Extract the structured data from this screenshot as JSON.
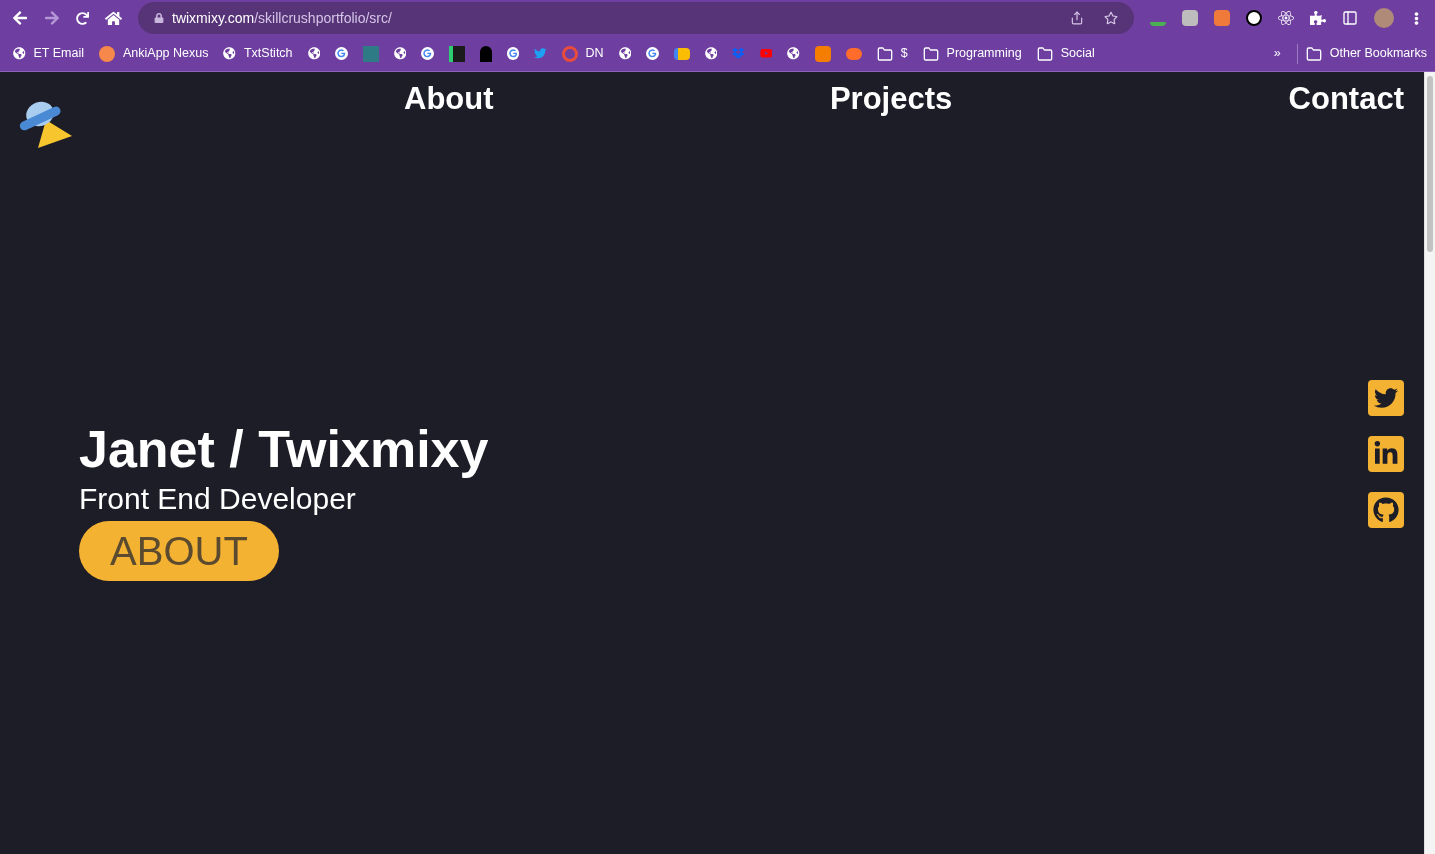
{
  "browser": {
    "url_host": "twixmixy.com",
    "url_path": "/skillcrushportfolio/src/"
  },
  "bookmarks": [
    {
      "kind": "site",
      "label": "ET Email"
    },
    {
      "kind": "site",
      "label": "AnkiApp Nexus"
    },
    {
      "kind": "site",
      "label": "TxtStitch"
    },
    {
      "kind": "site"
    },
    {
      "kind": "site"
    },
    {
      "kind": "site"
    },
    {
      "kind": "site"
    },
    {
      "kind": "site"
    },
    {
      "kind": "site"
    },
    {
      "kind": "site"
    },
    {
      "kind": "site"
    },
    {
      "kind": "site"
    },
    {
      "kind": "site",
      "label": "DN"
    },
    {
      "kind": "site"
    },
    {
      "kind": "site"
    },
    {
      "kind": "site"
    },
    {
      "kind": "site"
    },
    {
      "kind": "site"
    },
    {
      "kind": "site"
    },
    {
      "kind": "site"
    },
    {
      "kind": "site"
    },
    {
      "kind": "site"
    },
    {
      "kind": "folder",
      "label": "$"
    },
    {
      "kind": "folder",
      "label": "Programming"
    },
    {
      "kind": "folder",
      "label": "Social"
    }
  ],
  "bookmarks_overflow": "»",
  "other_bookmarks": "Other Bookmarks",
  "nav": [
    "About",
    "Projects",
    "Contact"
  ],
  "hero": {
    "name": "Janet / Twixmixy",
    "subtitle": "Front End Developer",
    "button": "ABOUT"
  }
}
